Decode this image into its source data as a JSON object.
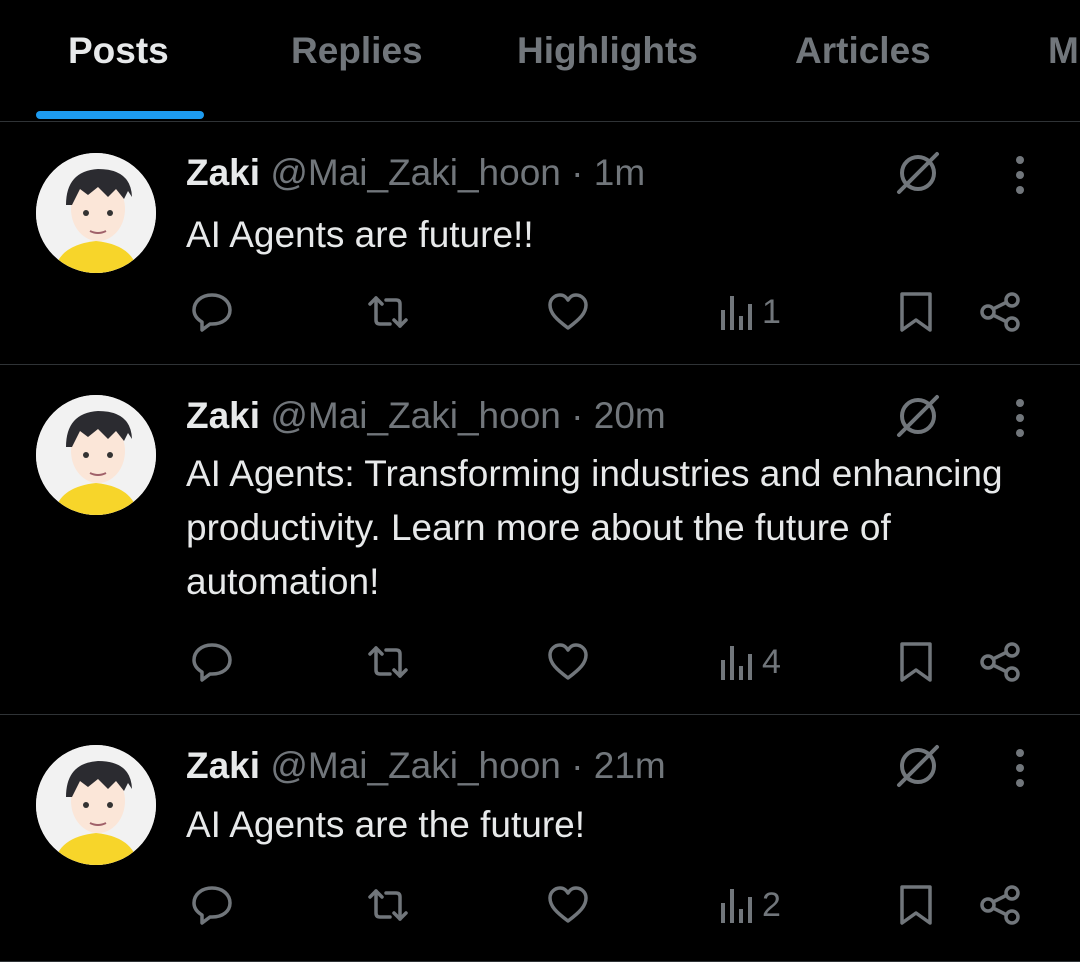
{
  "tabs": [
    {
      "label": "Posts",
      "active": true
    },
    {
      "label": "Replies",
      "active": false
    },
    {
      "label": "Highlights",
      "active": false
    },
    {
      "label": "Articles",
      "active": false
    },
    {
      "label": "M",
      "active": false
    }
  ],
  "posts": [
    {
      "name": "Zaki",
      "handle": "@Mai_Zaki_hoon",
      "separator": "·",
      "time": "1m",
      "text": "AI Agents are future!!",
      "views": "1"
    },
    {
      "name": "Zaki",
      "handle": "@Mai_Zaki_hoon",
      "separator": "·",
      "time": "20m",
      "text": "AI Agents: Transforming industries and enhancing productivity. Learn more about the future of automation!",
      "views": "4"
    },
    {
      "name": "Zaki",
      "handle": "@Mai_Zaki_hoon",
      "separator": "·",
      "time": "21m",
      "text": "AI Agents are the future!",
      "views": "2"
    }
  ],
  "icons": {
    "reply": "reply-icon",
    "repost": "repost-icon",
    "like": "like-icon",
    "views": "views-icon",
    "bookmark": "bookmark-icon",
    "share": "share-icon",
    "grok": "grok-icon",
    "more": "more-icon"
  },
  "colors": {
    "background": "#000000",
    "text": "#e7e9ea",
    "muted": "#71767b",
    "accent": "#1d9bf0",
    "divider": "#2f3336"
  }
}
